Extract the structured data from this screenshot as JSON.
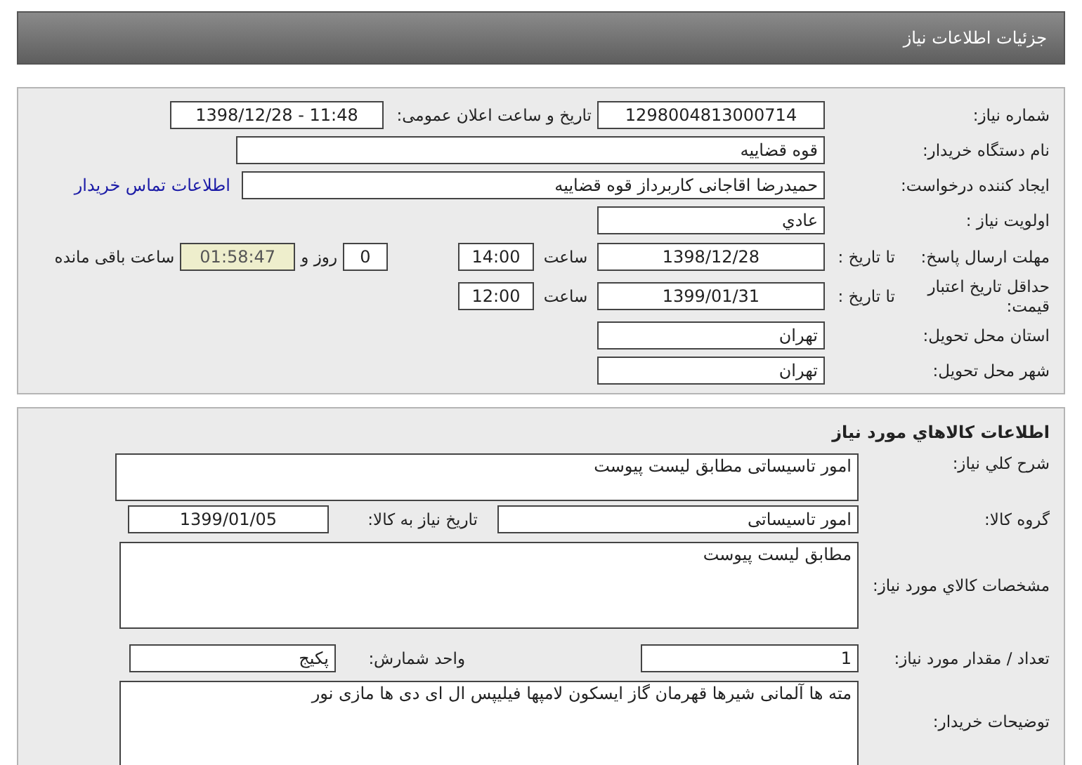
{
  "header": {
    "title": "جزئیات اطلاعات نیاز"
  },
  "details": {
    "need_number": {
      "label": "شماره نیاز:",
      "value": "1298004813000714"
    },
    "announce": {
      "label": "تاریخ و ساعت اعلان عمومی:",
      "value": "1398/12/28 - 11:48"
    },
    "buyer_org": {
      "label": "نام دستگاه خریدار:",
      "value": "قوه قضاییه"
    },
    "requester": {
      "label": "ایجاد کننده درخواست:",
      "value": "حمیدرضا اقاجانی کاربرداز قوه قضاییه",
      "link": "اطلاعات تماس خریدار"
    },
    "priority": {
      "label": "اولویت نیاز :",
      "value": "عادي"
    },
    "reply_deadline": {
      "label": "مهلت ارسال پاسخ:",
      "sub_label": "تا تاریخ :",
      "date": "1398/12/28",
      "time_label": "ساعت",
      "time": "14:00",
      "days": "0",
      "days_label": "روز و",
      "remaining": "01:58:47",
      "remaining_label": "ساعت باقی مانده"
    },
    "price_validity": {
      "label": "حداقل تاریخ اعتبار قیمت:",
      "sub_label": "تا تاریخ :",
      "date": "1399/01/31",
      "time_label": "ساعت",
      "time": "12:00"
    },
    "province": {
      "label": "استان محل تحویل:",
      "value": "تهران"
    },
    "city": {
      "label": "شهر محل تحویل:",
      "value": "تهران"
    }
  },
  "goods": {
    "title": "اطلاعات کالاهاي مورد نیاز",
    "summary": {
      "label": "شرح کلي نیاز:",
      "value": "امور تاسیساتی مطابق لیست پیوست"
    },
    "group": {
      "label": "گروه کالا:",
      "value": "امور تاسیساتی",
      "need_date_label": "تاریخ نیاز به کالا:",
      "need_date": "1399/01/05"
    },
    "specs": {
      "label": "مشخصات کالاي مورد نیاز:",
      "value": "مطابق لیست پیوست"
    },
    "quantity": {
      "label": "تعداد / مقدار مورد نیاز:",
      "value": "1",
      "unit_label": "واحد شمارش:",
      "unit": "پکیج"
    },
    "buyer_notes": {
      "label": "توضیحات خریدار:",
      "value": "مته ها آلمانی شیرها قهرمان گاز ایسکون لامپها فیلیپس ال ای دی ها مازی نور"
    }
  }
}
